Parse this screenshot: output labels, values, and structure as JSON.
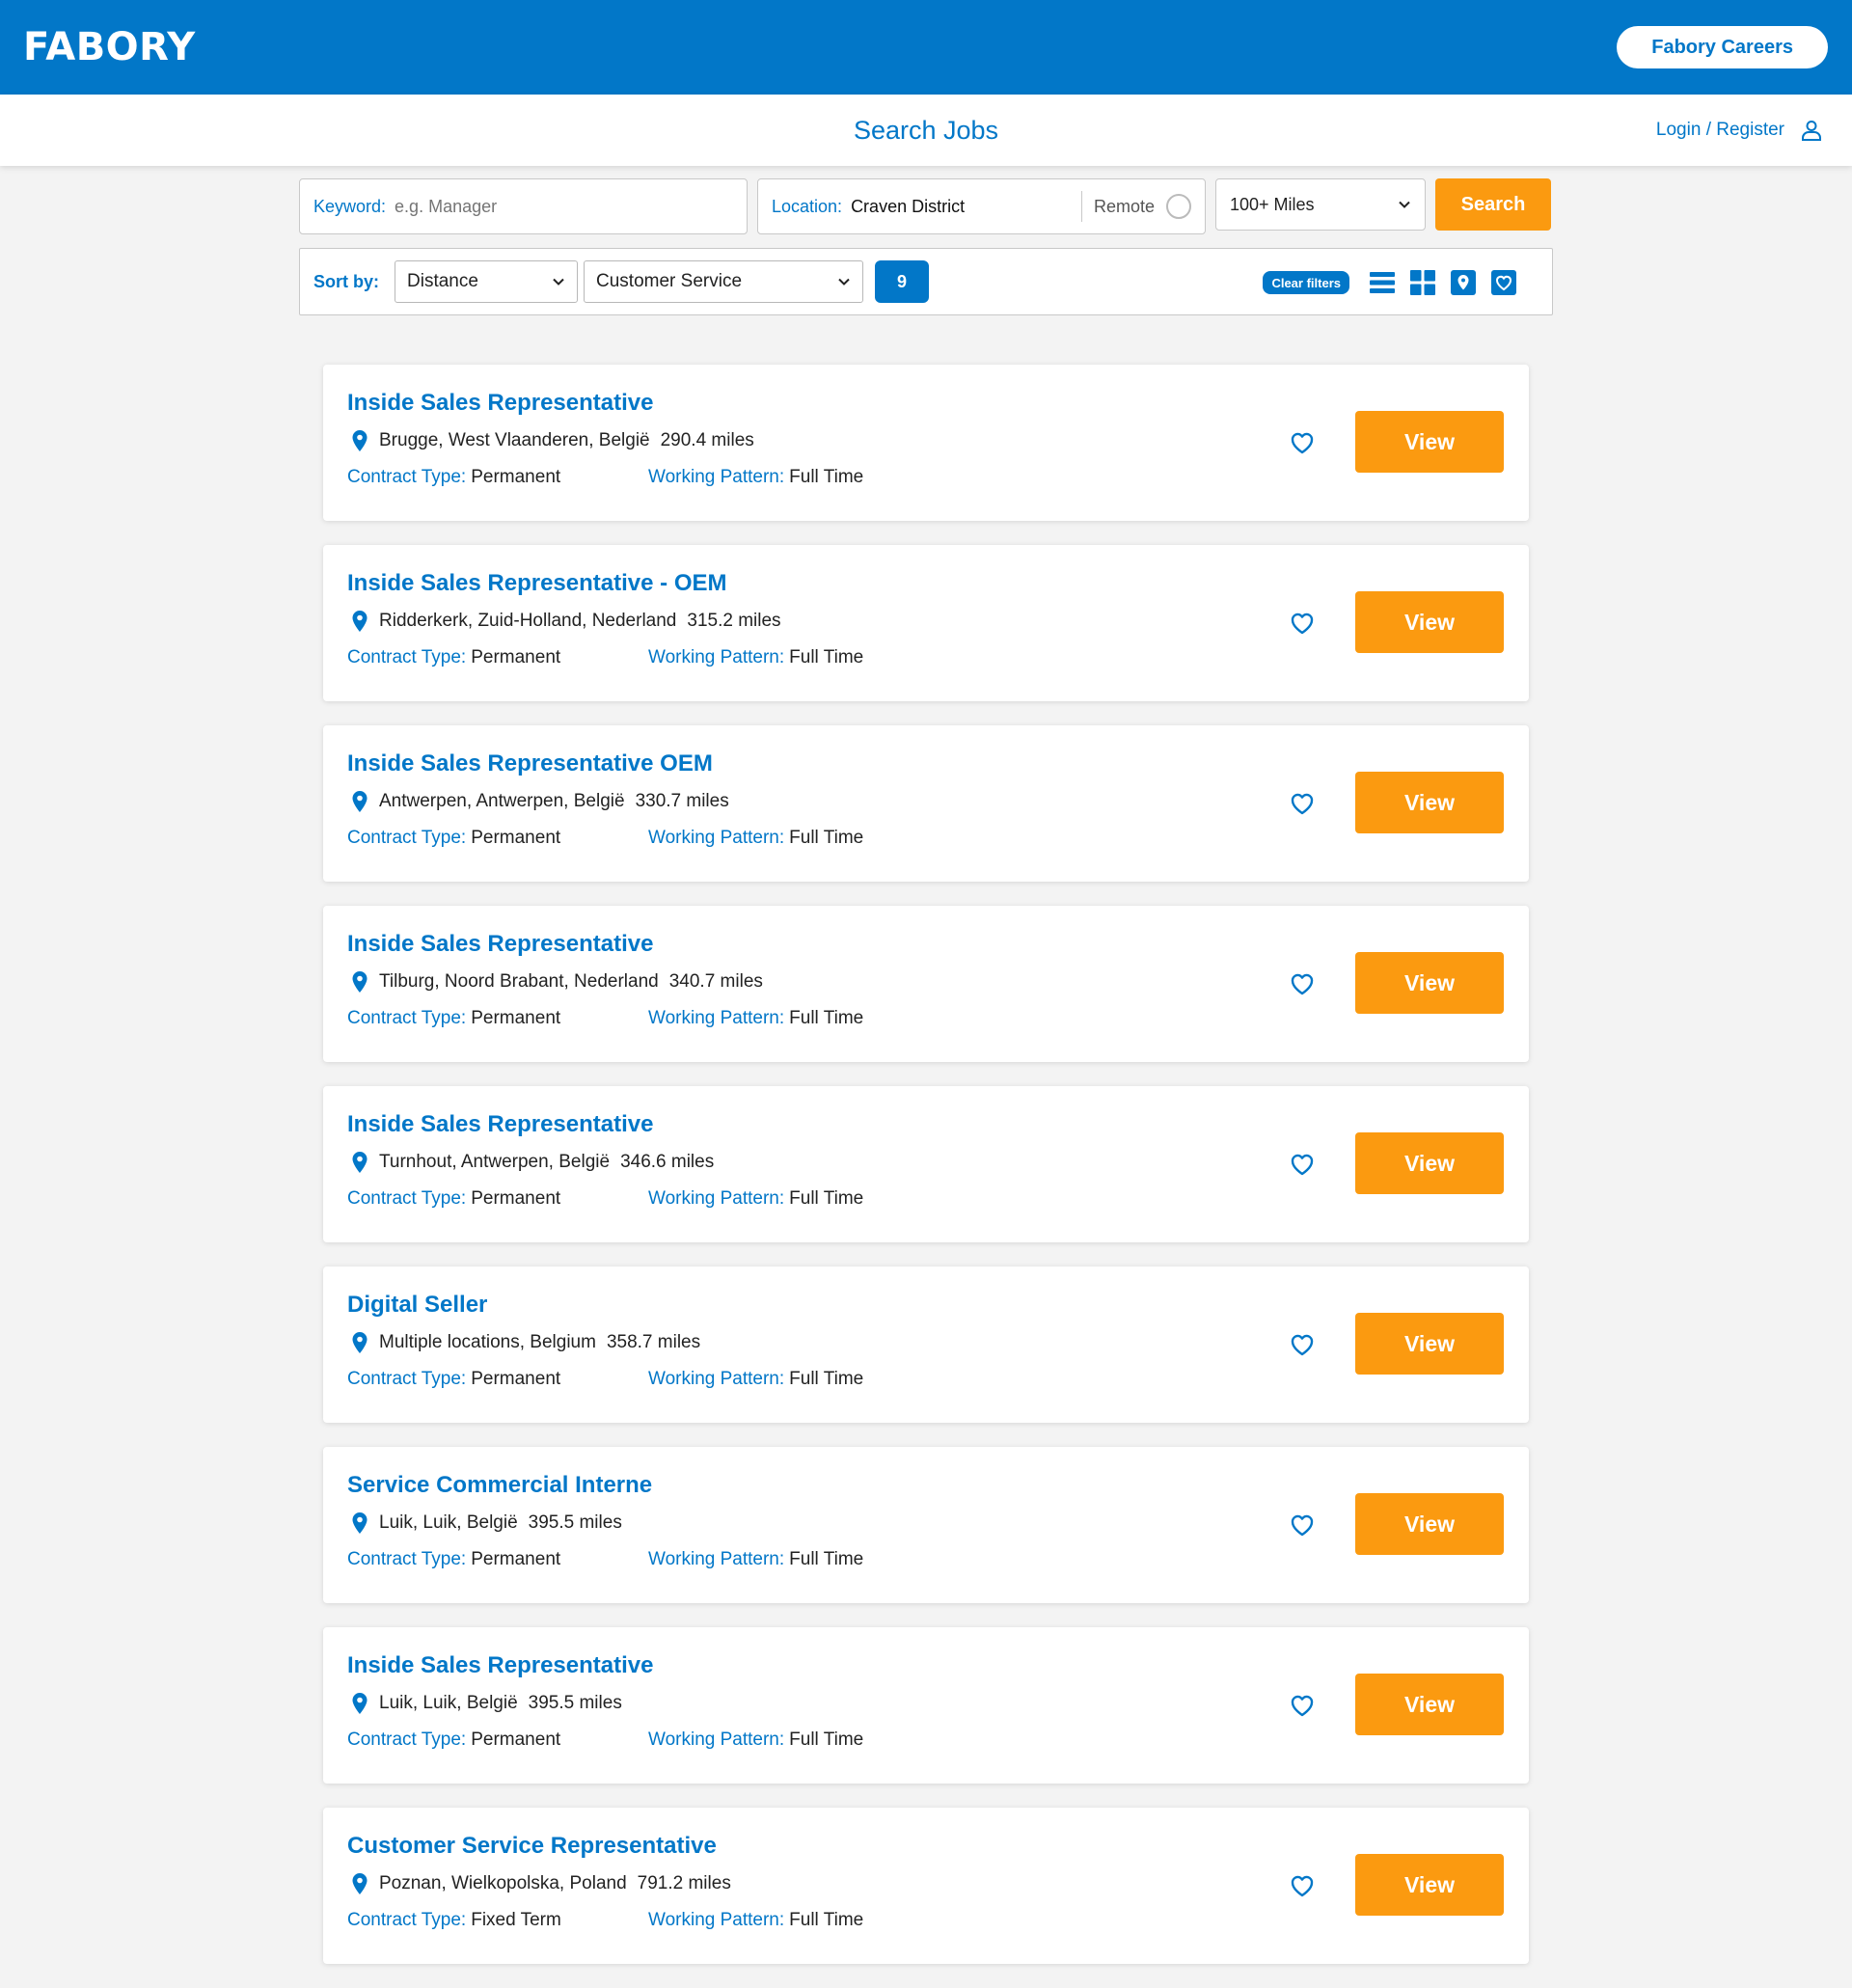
{
  "header": {
    "logo": "FABORY",
    "careers_button": "Fabory Careers"
  },
  "subheader": {
    "title": "Search Jobs",
    "login": "Login / Register"
  },
  "search": {
    "keyword_label": "Keyword:",
    "keyword_placeholder": "e.g. Manager",
    "location_label": "Location:",
    "location_value": "Craven District",
    "remote_label": "Remote",
    "radius": "100+ Miles",
    "search_button": "Search"
  },
  "filters": {
    "sort_label": "Sort by:",
    "sort_value": "Distance",
    "category_value": "Customer Service",
    "result_count": "9",
    "clear_label": "Clear filters"
  },
  "jobs": [
    {
      "title": "Inside Sales Representative",
      "location": "Brugge, West Vlaanderen, België",
      "distance": "290.4 miles",
      "contract_label": "Contract Type:",
      "contract": "Permanent",
      "pattern_label": "Working Pattern:",
      "pattern": "Full Time",
      "button": "View"
    },
    {
      "title": "Inside Sales Representative - OEM",
      "location": "Ridderkerk, Zuid-Holland, Nederland",
      "distance": "315.2 miles",
      "contract_label": "Contract Type:",
      "contract": "Permanent",
      "pattern_label": "Working Pattern:",
      "pattern": "Full Time",
      "button": "View"
    },
    {
      "title": "Inside Sales Representative OEM",
      "location": "Antwerpen, Antwerpen, België",
      "distance": "330.7 miles",
      "contract_label": "Contract Type:",
      "contract": "Permanent",
      "pattern_label": "Working Pattern:",
      "pattern": "Full Time",
      "button": "View"
    },
    {
      "title": "Inside Sales Representative",
      "location": "Tilburg, Noord Brabant, Nederland",
      "distance": "340.7 miles",
      "contract_label": "Contract Type:",
      "contract": "Permanent",
      "pattern_label": "Working Pattern:",
      "pattern": "Full Time",
      "button": "View"
    },
    {
      "title": "Inside Sales Representative",
      "location": "Turnhout, Antwerpen, België",
      "distance": "346.6 miles",
      "contract_label": "Contract Type:",
      "contract": "Permanent",
      "pattern_label": "Working Pattern:",
      "pattern": "Full Time",
      "button": "View"
    },
    {
      "title": "Digital Seller",
      "location": "Multiple locations, Belgium",
      "distance": "358.7 miles",
      "contract_label": "Contract Type:",
      "contract": "Permanent",
      "pattern_label": "Working Pattern:",
      "pattern": "Full Time",
      "button": "View"
    },
    {
      "title": "Service Commercial Interne",
      "location": "Luik, Luik, België",
      "distance": "395.5 miles",
      "contract_label": "Contract Type:",
      "contract": "Permanent",
      "pattern_label": "Working Pattern:",
      "pattern": "Full Time",
      "button": "View"
    },
    {
      "title": "Inside Sales Representative",
      "location": "Luik, Luik, België",
      "distance": "395.5 miles",
      "contract_label": "Contract Type:",
      "contract": "Permanent",
      "pattern_label": "Working Pattern:",
      "pattern": "Full Time",
      "button": "View"
    },
    {
      "title": "Customer Service Representative",
      "location": "Poznan, Wielkopolska, Poland",
      "distance": "791.2 miles",
      "contract_label": "Contract Type:",
      "contract": "Fixed Term",
      "pattern_label": "Working Pattern:",
      "pattern": "Full Time",
      "button": "View"
    }
  ],
  "icons": {
    "user": "user-icon",
    "chevron": "chevron-down-icon",
    "list_view": "list-view-icon",
    "grid_view": "grid-view-icon",
    "map_view": "map-pin-icon",
    "favourites": "heart-icon",
    "location": "location-pin-icon"
  },
  "colors": {
    "brand_blue": "#0277c8",
    "accent_orange": "#fb9a10"
  }
}
